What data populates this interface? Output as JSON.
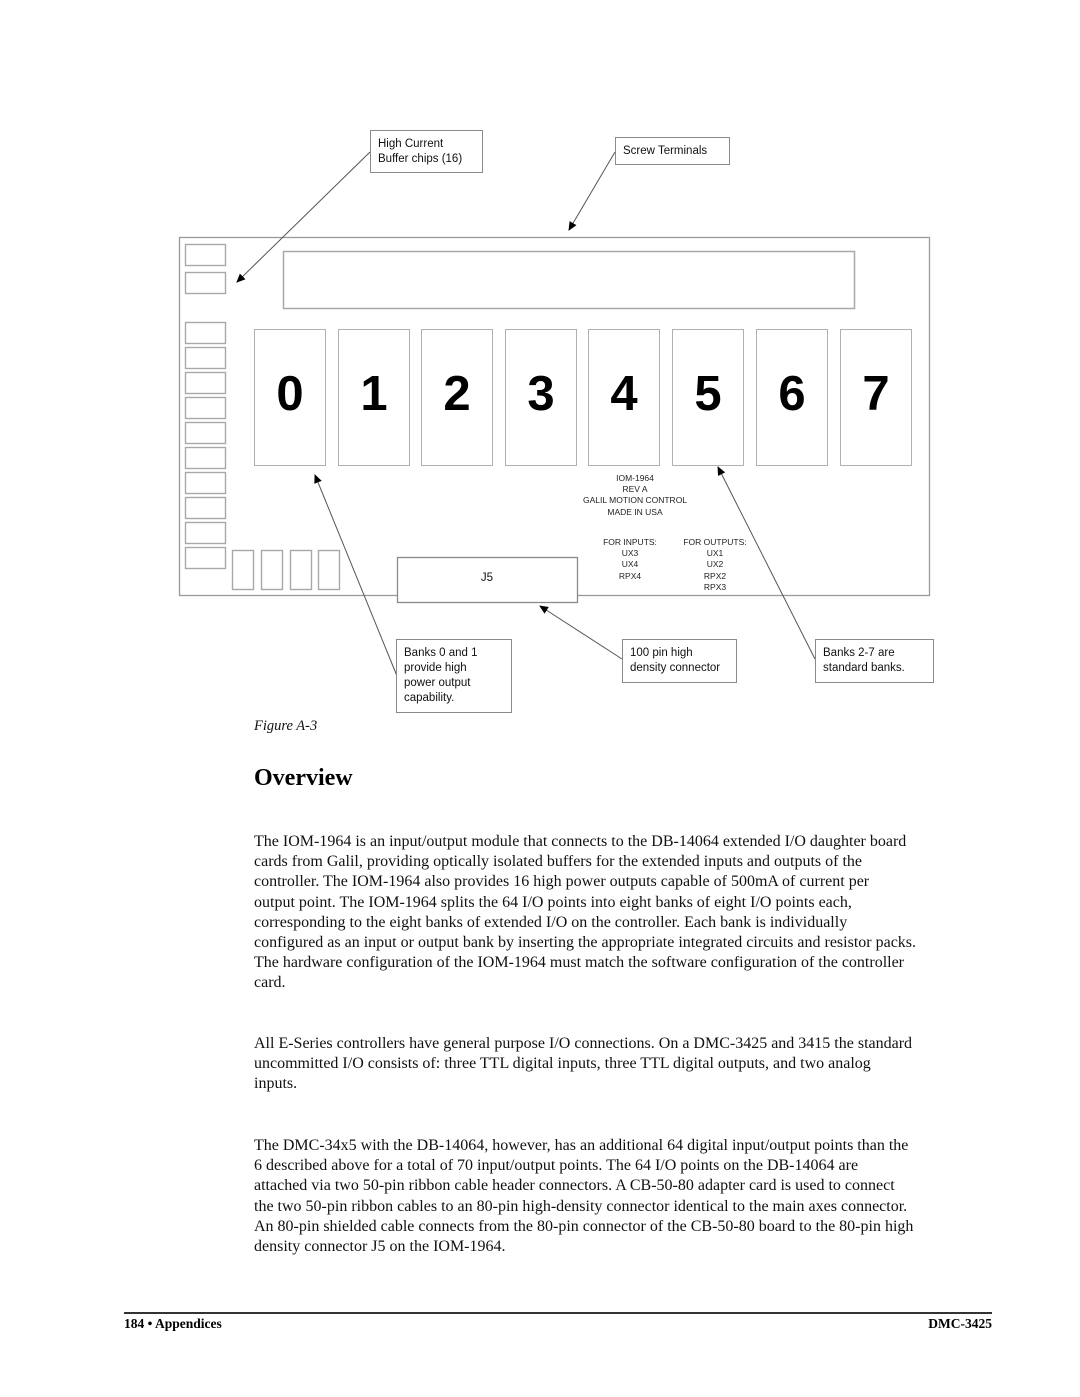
{
  "figure": {
    "callouts": {
      "buffer_chips": [
        "High Current",
        "Buffer chips (16)"
      ],
      "screw_terminals": [
        "Screw Terminals"
      ],
      "banks_0_1": [
        "Banks 0 and 1",
        "provide high",
        "power output",
        "capability."
      ],
      "connector": [
        "100 pin high",
        "density connector"
      ],
      "banks_2_7": [
        "Banks 2-7 are",
        "standard banks."
      ]
    },
    "banks": [
      "0",
      "1",
      "2",
      "3",
      "4",
      "5",
      "6",
      "7"
    ],
    "board_label": [
      "IOM-1964",
      "REV A",
      "GALIL MOTION CONTROL",
      "MADE IN USA"
    ],
    "inputs": {
      "title": "FOR INPUTS:",
      "items": [
        "UX3",
        "UX4",
        "RPX4"
      ]
    },
    "outputs": {
      "title": "FOR OUTPUTS:",
      "items": [
        "UX1",
        "UX2",
        "RPX2",
        "RPX3"
      ]
    },
    "connector_label": "J5",
    "caption": "Figure A-3"
  },
  "section": {
    "heading": "Overview",
    "paragraphs": [
      [
        "The IOM-1964 is an input/output module that connects to the DB-14064 extended I/O daughter board",
        "cards from Galil, providing optically isolated buffers for the extended inputs and outputs of the",
        "controller.  The IOM-1964 also provides 16 high power outputs capable of 500mA of current per",
        "output point.  The IOM-1964 splits the 64 I/O points into eight banks of eight I/O points each,",
        "corresponding to the eight banks of extended I/O on the controller.  Each bank is individually",
        "configured as an input or output bank by inserting the appropriate integrated circuits and resistor packs.",
        "The hardware configuration of the IOM-1964 must match the software configuration of the controller",
        "card."
      ],
      [
        "All E-Series controllers have general purpose I/O connections.  On a DMC-3425 and 3415 the standard",
        "uncommitted I/O consists of: three TTL digital inputs, three TTL digital outputs, and two analog",
        "inputs."
      ],
      [
        "The DMC-34x5 with the DB-14064, however, has an additional 64 digital input/output points than the",
        "6 described above for a total of 70 input/output points.  The 64 I/O points on the DB-14064 are",
        "attached via two 50-pin ribbon cable header connectors.  A CB-50-80 adapter card is used to connect",
        "the two 50-pin ribbon cables to an 80-pin high-density connector identical to the main axes connector.",
        "An 80-pin shielded cable connects from the 80-pin connector of the CB-50-80 board to the 80-pin high",
        "density connector J5 on the IOM-1964."
      ]
    ]
  },
  "footer": {
    "left": "184 • Appendices",
    "right": "DMC-3425"
  }
}
